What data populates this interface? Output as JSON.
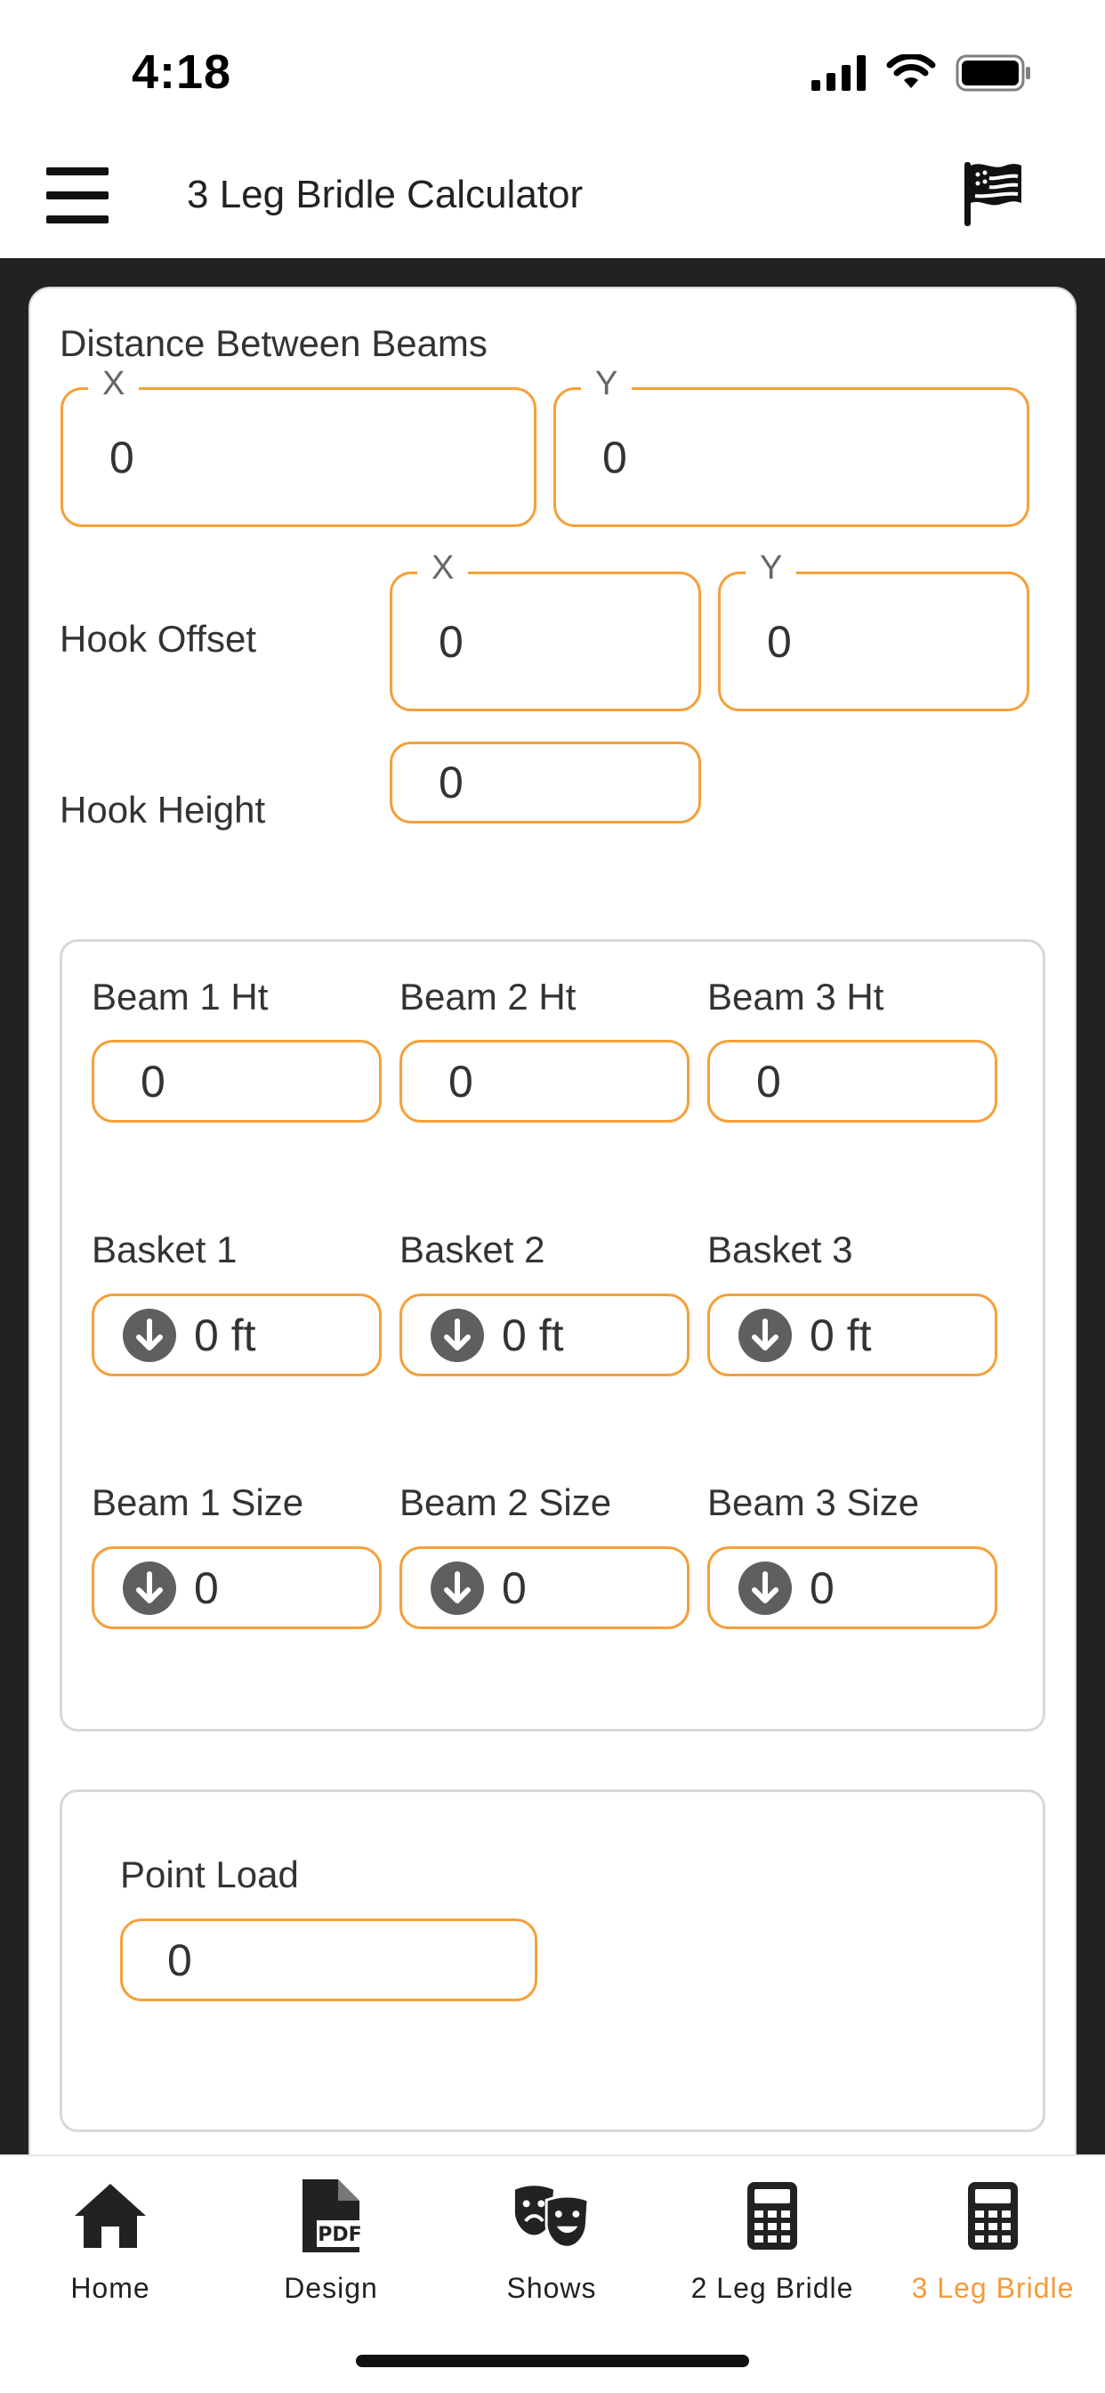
{
  "status": {
    "time": "4:18"
  },
  "header": {
    "title": "3 Leg Bridle Calculator",
    "menu_icon": "hamburger-menu-icon",
    "flag_icon": "us-flag-icon"
  },
  "distance_between_beams": {
    "label": "Distance Between Beams",
    "x_legend": "X",
    "x_value": "0",
    "y_legend": "Y",
    "y_value": "0"
  },
  "hook_offset": {
    "label": "Hook Offset",
    "x_legend": "X",
    "x_value": "0",
    "y_legend": "Y",
    "y_value": "0"
  },
  "hook_height": {
    "label": "Hook Height",
    "value": "0"
  },
  "beams": {
    "heights": [
      {
        "label": "Beam 1 Ht",
        "value": "0"
      },
      {
        "label": "Beam 2 Ht",
        "value": "0"
      },
      {
        "label": "Beam 3 Ht",
        "value": "0"
      }
    ],
    "baskets": [
      {
        "label": "Basket 1",
        "value": "0 ft"
      },
      {
        "label": "Basket 2",
        "value": "0 ft"
      },
      {
        "label": "Basket 3",
        "value": "0 ft"
      }
    ],
    "sizes": [
      {
        "label": "Beam 1 Size",
        "value": "0"
      },
      {
        "label": "Beam 2 Size",
        "value": "0"
      },
      {
        "label": "Beam 3 Size",
        "value": "0"
      }
    ]
  },
  "point_load": {
    "label": "Point Load",
    "value": "0"
  },
  "nav": [
    {
      "label": "Home",
      "icon": "home-icon"
    },
    {
      "label": "Design",
      "icon": "pdf-file-icon"
    },
    {
      "label": "Shows",
      "icon": "theater-masks-icon"
    },
    {
      "label": "2 Leg Bridle",
      "icon": "calculator-icon"
    },
    {
      "label": "3 Leg Bridle",
      "icon": "calculator-icon",
      "active": true
    }
  ],
  "colors": {
    "accent": "#f39b3b",
    "field_border": "#f5a03a",
    "background_dark": "#222222",
    "icon_gray": "#5f5f5f"
  }
}
